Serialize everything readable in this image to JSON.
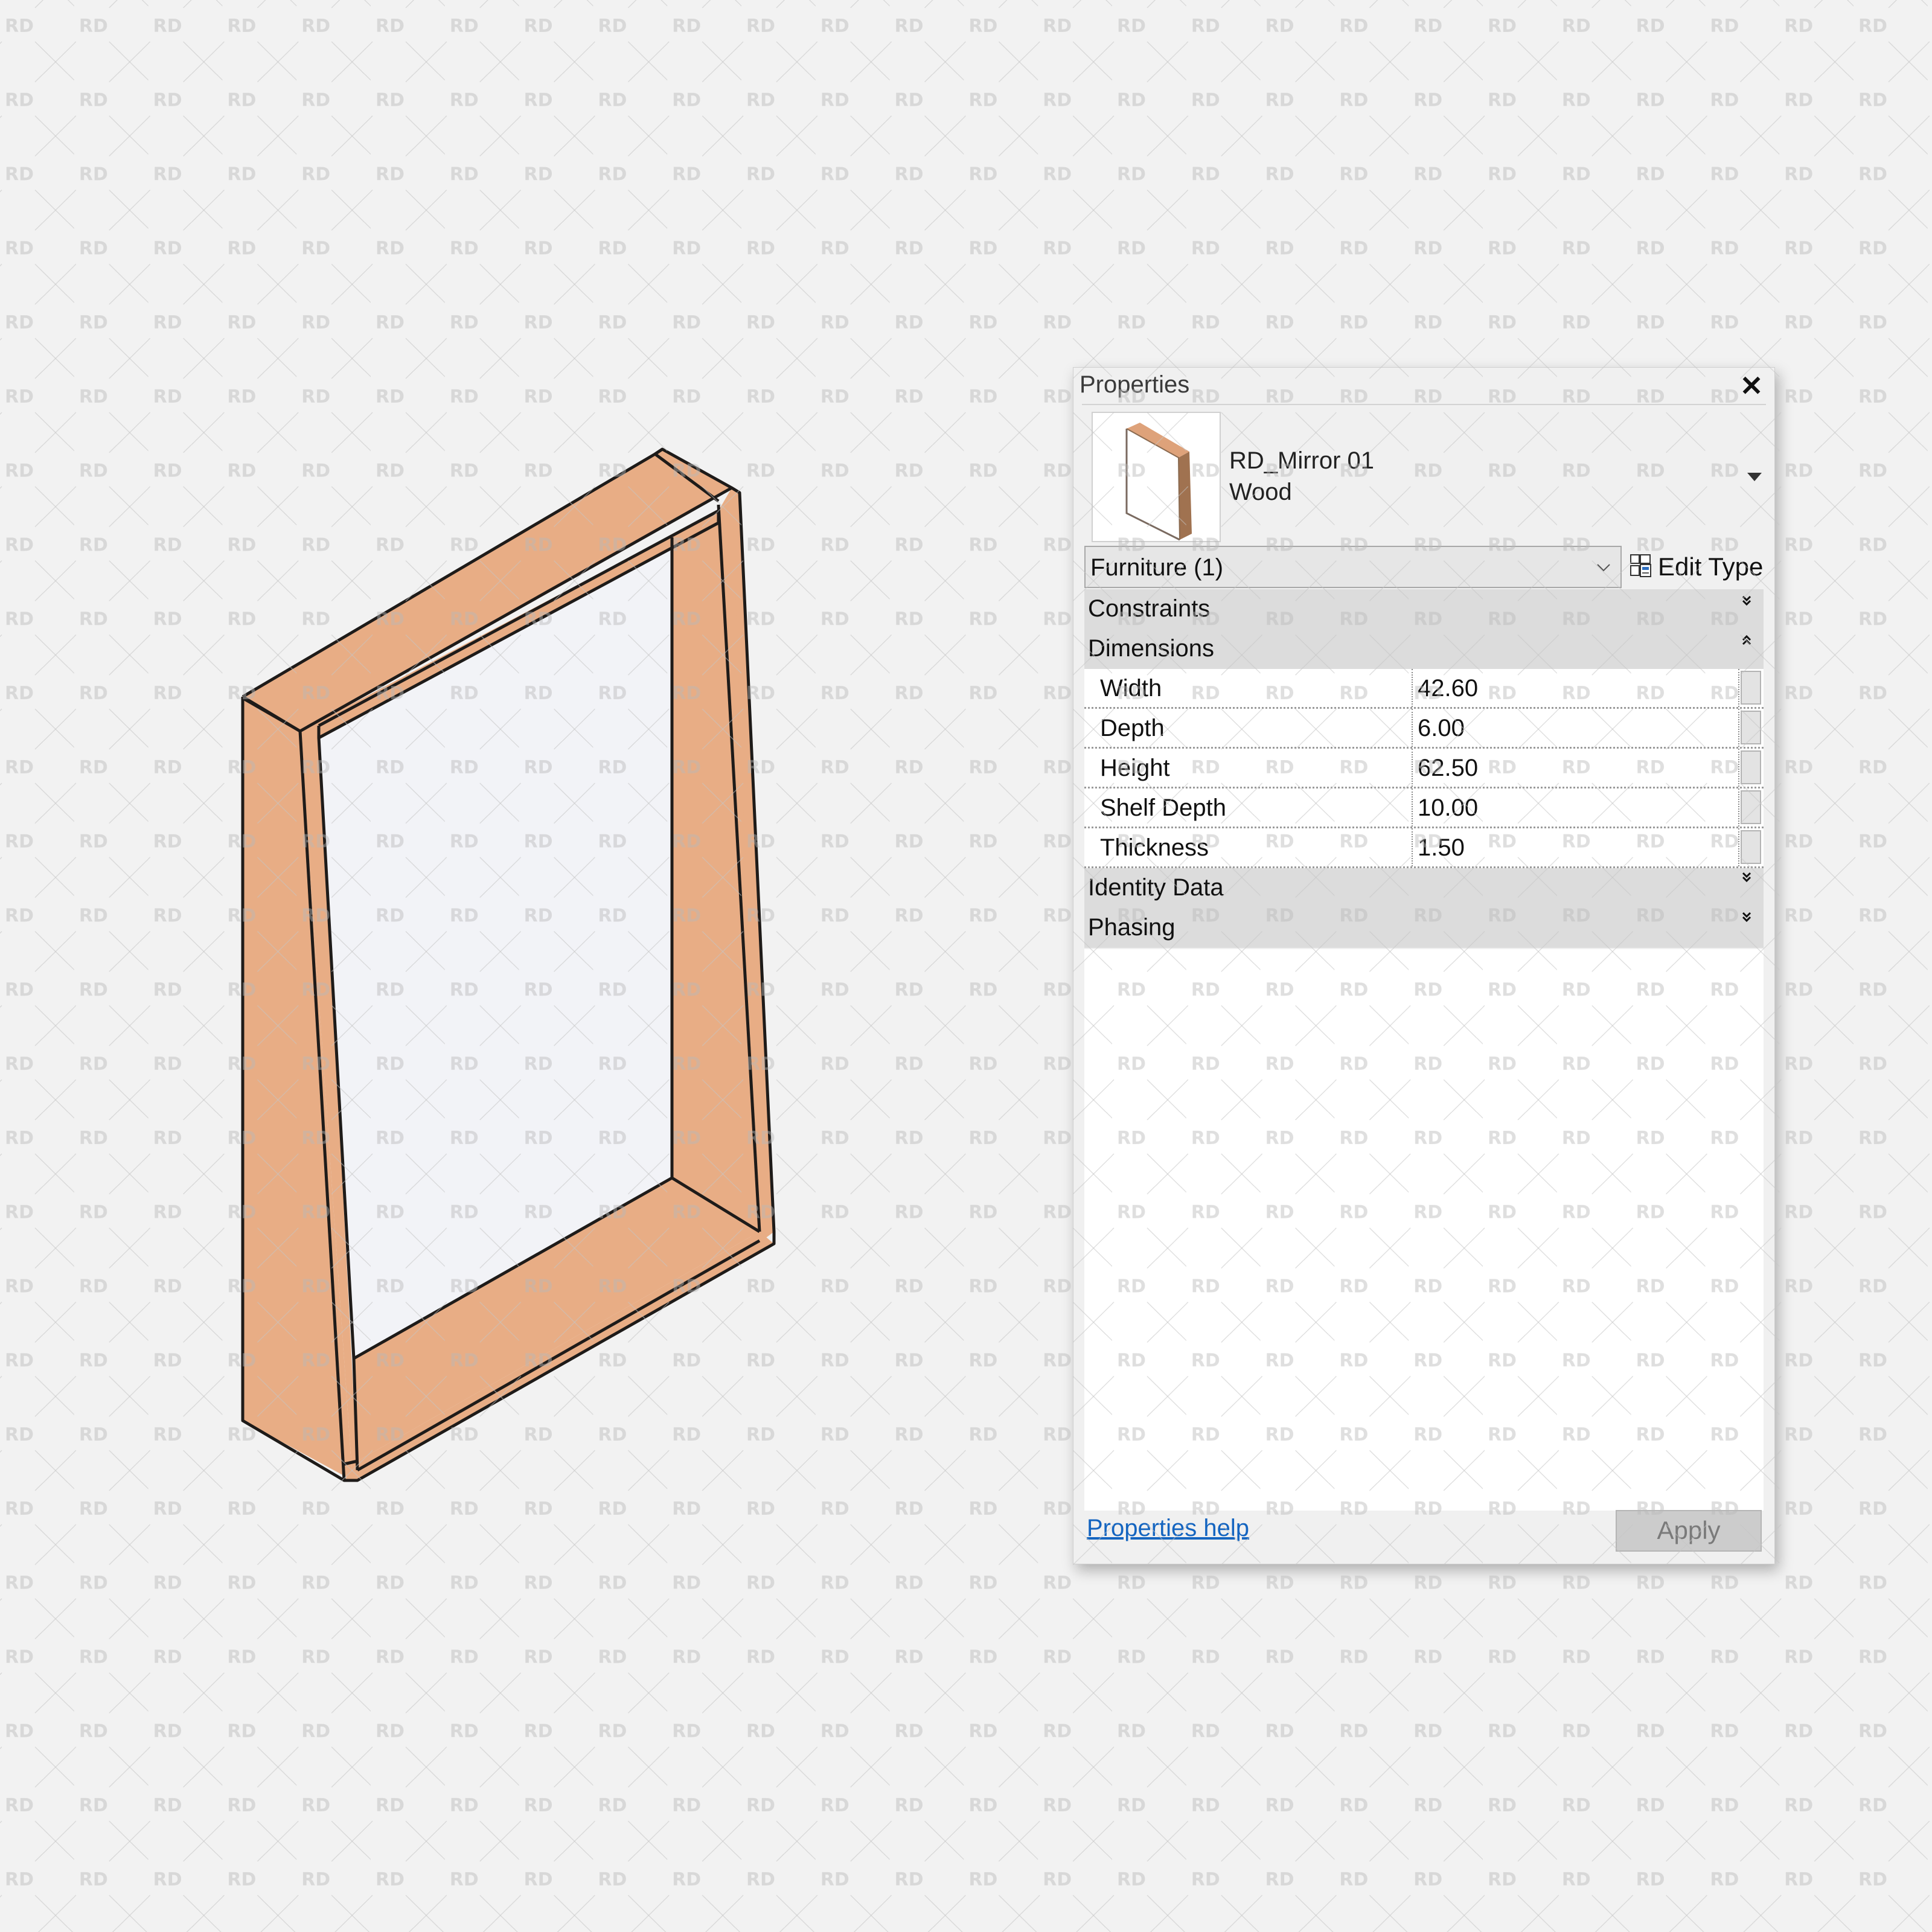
{
  "canvas": {
    "background_color": "#f2f2f2",
    "watermark_text": "RD",
    "model": {
      "name": "mirror-frame-3d-view",
      "frame_color": "#e8ad85",
      "glass_color": "#f2f3f7",
      "edge_color": "#1e1b19"
    }
  },
  "properties_panel": {
    "title": "Properties",
    "close_icon": "close-icon",
    "type_selector": {
      "family_name": "RD_Mirror 01",
      "type_name": "Wood",
      "dropdown_icon": "triangle-down-icon"
    },
    "category_filter": {
      "selected": "Furniture (1)",
      "icon": "chevron-down-icon"
    },
    "edit_type": {
      "label": "Edit Type",
      "icon": "edit-type-icon"
    },
    "groups": [
      {
        "label": "Constraints",
        "state": "collapsed",
        "toggle_icon": "double-chevron-down-icon"
      },
      {
        "label": "Dimensions",
        "state": "expanded",
        "toggle_icon": "double-chevron-up-icon"
      }
    ],
    "dimension_rows": [
      {
        "name": "Width",
        "value": "42.60"
      },
      {
        "name": "Depth",
        "value": "6.00"
      },
      {
        "name": "Height",
        "value": "62.50"
      },
      {
        "name": "Shelf Depth",
        "value": "10.00"
      },
      {
        "name": "Thickness",
        "value": "1.50"
      }
    ],
    "trailing_groups": [
      {
        "label": "Identity Data",
        "state": "collapsed",
        "toggle_icon": "double-chevron-down-icon"
      },
      {
        "label": "Phasing",
        "state": "collapsed",
        "toggle_icon": "double-chevron-down-icon"
      }
    ],
    "footer": {
      "help_link": "Properties help",
      "apply_label": "Apply",
      "link_color": "#1565c0"
    }
  }
}
